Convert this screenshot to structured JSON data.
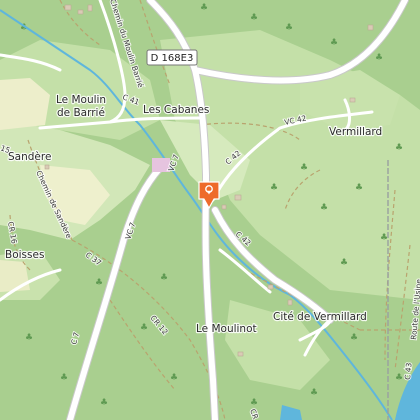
{
  "map": {
    "places": {
      "moulin_de_barrie_line1": "Le Moulin",
      "moulin_de_barrie_line2": "de Barrié",
      "les_cabanes": "Les Cabanes",
      "vermillard": "Vermillard",
      "sandere": "Sandère",
      "boisses": "Boisses",
      "le_moulinot": "Le Moulinot",
      "cite_de_vermillard": "Cité de Vermillard"
    },
    "road_shield": "D 168E3",
    "roads": {
      "chemin_du_moulin_barrie": "Chemin du Moulin Barrié",
      "c41": "C 41",
      "c42_upper": "VC 42",
      "c42_mid": "C 42",
      "c42_lower": "C 42",
      "vc7_upper": "VC 7",
      "vc7_lower": "VC 7",
      "c7": "C 7",
      "chemin_de_sandere": "Chemin de Sandère",
      "cr16": "CR 16",
      "c37": "C 37",
      "cr12": "CR 12",
      "c43": "C 43",
      "route_de_lusine": "Route de l'Usine",
      "cr_bottom": "CR",
      "c15": "15"
    },
    "marker": {
      "icon": "location-pin-icon",
      "color": "#ee6b2b"
    },
    "colors": {
      "forest": "#a9cf8f",
      "meadow": "#cde5b4",
      "field": "#f0efcf",
      "water": "#5fb6dc",
      "road": "#ffffff"
    }
  }
}
